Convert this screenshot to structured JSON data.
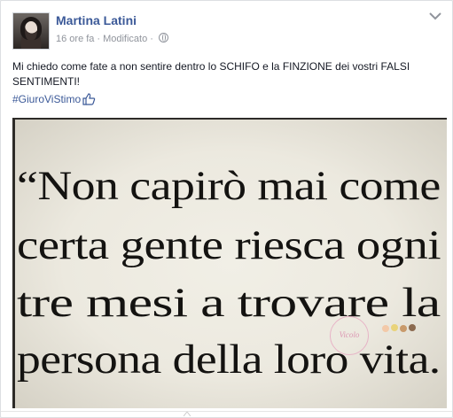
{
  "post": {
    "author": "Martina Latini",
    "time": "16 ore fa",
    "edited": "Modificato",
    "text": "Mi chiedo come fate a non sentire dentro lo SCHIFO e la FINZIONE dei vostri FALSI SENTIMENTI!",
    "hashtag": "#GiuroViStimo",
    "icons": [
      "chevron-down-icon",
      "globe-icon",
      "thumbs-up-icon"
    ]
  },
  "image": {
    "lines": [
      "“Non capirò mai come",
      "certa gente riesca ogni",
      "tre mesi a trovare la",
      "persona della loro vita."
    ],
    "watermark": "Vicolo"
  },
  "colors": {
    "link": "#3b5998",
    "meta": "#90949c",
    "text": "#141823"
  }
}
